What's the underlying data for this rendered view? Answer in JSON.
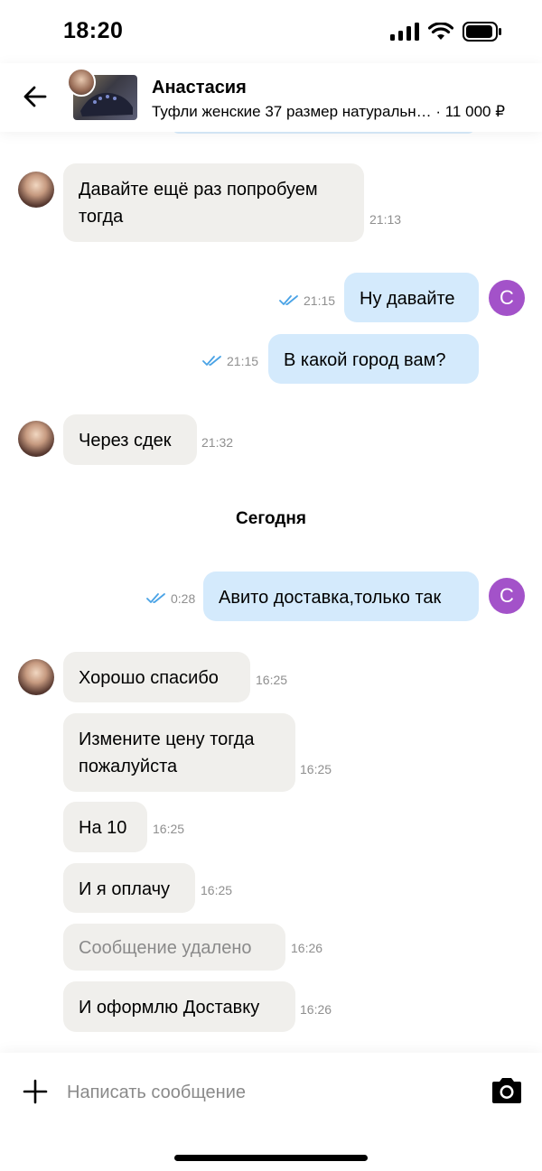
{
  "status_bar": {
    "time": "18:20"
  },
  "header": {
    "name": "Анастасия",
    "listing_title": "Туфли женские 37 размер натуральн…",
    "listing_price": "· 11 000 ₽"
  },
  "messages": [
    {
      "dir": "in",
      "text_lines": [
        "Давайте ещё раз попробуем",
        "тогда"
      ],
      "time": "21:13"
    },
    {
      "dir": "out",
      "text": "Ну давайте",
      "time": "21:15",
      "status": "read",
      "avatar_letter": "С"
    },
    {
      "dir": "out",
      "text": "В какой город вам?",
      "time": "21:15",
      "status": "read"
    },
    {
      "dir": "in",
      "text": "Через сдек",
      "time": "21:32"
    },
    {
      "dir": "out",
      "text": "Авито доставка,только так",
      "time": "0:28",
      "status": "read",
      "avatar_letter": "С"
    },
    {
      "dir": "in",
      "text": "Хорошо спасибо",
      "time": "16:25"
    },
    {
      "dir": "in",
      "text_lines": [
        "Измените цену тогда",
        "пожалуйста"
      ],
      "time": "16:25"
    },
    {
      "dir": "in",
      "text": "На 10",
      "time": "16:25"
    },
    {
      "dir": "in",
      "text": "И я оплачу",
      "time": "16:25"
    },
    {
      "dir": "in",
      "text": "Сообщение удалено",
      "time": "16:26",
      "deleted": true
    },
    {
      "dir": "in",
      "text": "И оформлю Доставку",
      "time": "16:26"
    }
  ],
  "day_separator": "Сегодня",
  "composer": {
    "placeholder": "Написать сообщение"
  },
  "colors": {
    "incoming_bubble": "#f0efec",
    "outgoing_bubble": "#d4eafc",
    "read_ticks": "#4aa3e6",
    "my_avatar": "#a352c9"
  },
  "icons": {
    "back": "arrow-left-icon",
    "plus": "plus-icon",
    "camera": "camera-icon",
    "read": "double-check-icon"
  }
}
